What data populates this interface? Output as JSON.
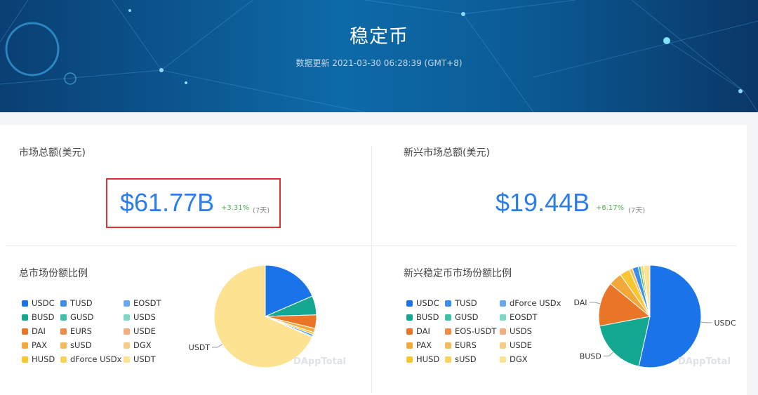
{
  "header": {
    "title": "稳定币",
    "update": "数据更新 2021-03-30 06:28:39 (GMT+8)"
  },
  "total": {
    "label": "市场总额(美元)",
    "value": "$61.77B",
    "change": "+3.31%",
    "period": "(7天)"
  },
  "emerging": {
    "label": "新兴市场总额(美元)",
    "value": "$19.44B",
    "change": "+6.17%",
    "period": "(7天)"
  },
  "watermark": "DAppTotal",
  "legend_left": [
    {
      "name": "USDC",
      "color": "#1a73e8"
    },
    {
      "name": "TUSD",
      "color": "#3d8ee8"
    },
    {
      "name": "EOSDT",
      "color": "#6aa8ee"
    },
    {
      "name": "BUSD",
      "color": "#13a88f"
    },
    {
      "name": "GUSD",
      "color": "#3dbfa8"
    },
    {
      "name": "USDS",
      "color": "#7dd6c6"
    },
    {
      "name": "DAI",
      "color": "#ea7526"
    },
    {
      "name": "EURS",
      "color": "#f08c4a"
    },
    {
      "name": "USDE",
      "color": "#f3ad82"
    },
    {
      "name": "PAX",
      "color": "#f2a93b"
    },
    {
      "name": "sUSD",
      "color": "#f3bb5d"
    },
    {
      "name": "DGX",
      "color": "#f5cb85"
    },
    {
      "name": "HUSD",
      "color": "#f8c630"
    },
    {
      "name": "dForce USDx",
      "color": "#f8d45a"
    },
    {
      "name": "USDT",
      "color": "#fde391"
    }
  ],
  "legend_right": [
    {
      "name": "USDC",
      "color": "#1a73e8"
    },
    {
      "name": "TUSD",
      "color": "#3d8ee8"
    },
    {
      "name": "dForce USDx",
      "color": "#6aa8ee"
    },
    {
      "name": "BUSD",
      "color": "#13a88f"
    },
    {
      "name": "GUSD",
      "color": "#3dbfa8"
    },
    {
      "name": "EOSDT",
      "color": "#7dd6c6"
    },
    {
      "name": "DAI",
      "color": "#ea7526"
    },
    {
      "name": "EOS-USDT",
      "color": "#f08c4a"
    },
    {
      "name": "USDS",
      "color": "#f3ad82"
    },
    {
      "name": "PAX",
      "color": "#f2a93b"
    },
    {
      "name": "EURS",
      "color": "#f3bb5d"
    },
    {
      "name": "USDE",
      "color": "#f5cb85"
    },
    {
      "name": "HUSD",
      "color": "#f8c630"
    },
    {
      "name": "sUSD",
      "color": "#f8d45a"
    },
    {
      "name": "DGX",
      "color": "#fde391"
    }
  ],
  "chart_data": [
    {
      "type": "pie",
      "title": "总市场份额比例",
      "slices": [
        {
          "name": "USDC",
          "value": 18.5,
          "color": "#1a73e8"
        },
        {
          "name": "BUSD",
          "value": 6.0,
          "color": "#13a88f"
        },
        {
          "name": "DAI",
          "value": 4.3,
          "color": "#ea7526"
        },
        {
          "name": "PAX",
          "value": 1.3,
          "color": "#f2a93b"
        },
        {
          "name": "HUSD",
          "value": 0.7,
          "color": "#f8c630"
        },
        {
          "name": "TUSD",
          "value": 0.6,
          "color": "#3d8ee8"
        },
        {
          "name": "GUSD",
          "value": 0.3,
          "color": "#3dbfa8"
        },
        {
          "name": "USDT",
          "value": 68.3,
          "color": "#fde391"
        }
      ],
      "labels_shown": [
        "USDT"
      ]
    },
    {
      "type": "pie",
      "title": "新兴稳定币市场份额比例",
      "slices": [
        {
          "name": "USDC",
          "value": 53.5,
          "color": "#1a73e8"
        },
        {
          "name": "BUSD",
          "value": 18.5,
          "color": "#13a88f"
        },
        {
          "name": "DAI",
          "value": 14.0,
          "color": "#ea7526"
        },
        {
          "name": "PAX",
          "value": 4.2,
          "color": "#f2a93b"
        },
        {
          "name": "HUSD",
          "value": 3.2,
          "color": "#f8c630"
        },
        {
          "name": "EURS",
          "value": 1.0,
          "color": "#f3bb5d"
        },
        {
          "name": "TUSD",
          "value": 1.9,
          "color": "#3d8ee8"
        },
        {
          "name": "GUSD",
          "value": 0.8,
          "color": "#3dbfa8"
        },
        {
          "name": "sUSD",
          "value": 0.8,
          "color": "#f8d45a"
        },
        {
          "name": "DGX",
          "value": 2.1,
          "color": "#fde391"
        }
      ],
      "labels_shown": [
        "USDC",
        "BUSD",
        "DAI"
      ]
    }
  ]
}
